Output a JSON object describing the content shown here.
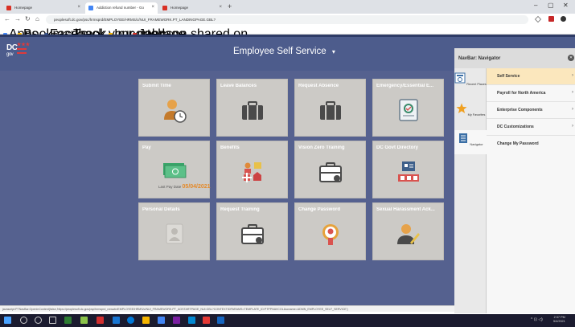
{
  "browser": {
    "tabs": [
      {
        "label": "Homepage",
        "fav_color": "#d93025",
        "active": false
      },
      {
        "label": "Addiction refund number - Go",
        "fav_color": "#4285f4",
        "active": true
      },
      {
        "label": "Homepage",
        "fav_color": "#d93025",
        "active": false
      }
    ],
    "new_tab": "+",
    "window_controls": {
      "minimize": "–",
      "maximize": "▢",
      "close": "✕"
    },
    "nav": {
      "back": "←",
      "forward": "→",
      "reload": "↻",
      "home": "⌂"
    },
    "url": "peoplesoft.dc.gov/psc/hrmsprd/EMPLOYEE/HRMS/c/NUI_FRAMEWORK.PT_LANDINGPAGE.GBL?",
    "bookmarks": [
      {
        "label": "Apps",
        "color": "#4285f4"
      },
      {
        "label": "Bookmarks",
        "color": "#f4b400"
      },
      {
        "label": "Facebook",
        "color": "#3b5998"
      },
      {
        "label": "Track your package...",
        "color": "#aaaaaa"
      },
      {
        "label": "Imported",
        "color": "#f4b400"
      },
      {
        "label": "Johnson shared on...",
        "color": "#d93025"
      }
    ]
  },
  "app": {
    "logo_text": "DC",
    "logo_sub": "gov",
    "title": "Employee Self Service",
    "title_caret": "▾"
  },
  "tiles": [
    {
      "title": "Submit Time",
      "icon": "person-clock-icon"
    },
    {
      "title": "Leave Balances",
      "icon": "briefcase-icon"
    },
    {
      "title": "Request Absence",
      "icon": "briefcase-icon"
    },
    {
      "title": "Emergency/Essential E...",
      "icon": "document-gear-icon"
    },
    {
      "title": "Pay",
      "icon": "money-icon",
      "pay_label": "Last Pay Date",
      "pay_date": "05/04/2021"
    },
    {
      "title": "Benefits",
      "icon": "benefits-icon"
    },
    {
      "title": "Vision Zero Training",
      "icon": "training-briefcase-icon"
    },
    {
      "title": "DC Govt Directory",
      "icon": "directory-icon"
    },
    {
      "title": "Personal Details",
      "icon": "personal-details-icon"
    },
    {
      "title": "Request Training",
      "icon": "training-briefcase-icon"
    },
    {
      "title": "Change Password",
      "icon": "password-badge-icon"
    },
    {
      "title": "Sexual Harassment Ack...",
      "icon": "person-pen-icon"
    }
  ],
  "status_url": "javascript:PTNavBar.OpenInContent(false,'https://peoplesoft.dc.gov/psp/hrmsprd_newwin/EMPLOYEE/HRMS/c/NUI_FRAMEWORK.PT_AGSTARTPAGE_NUI.GBL?CONTEXTIDPARAMS=TEMPLATE_ID:PTPPNAVCOL&scname=ADMN_EMPLOYEE_SELF_SERVICE')",
  "navbar": {
    "title": "NavBar: Navigator",
    "close": "✕",
    "side": [
      {
        "label": "Recent Places",
        "icon": "recent-places-icon"
      },
      {
        "label": "My Favorites",
        "icon": "star-icon"
      },
      {
        "label": "Navigator",
        "icon": "navigator-icon"
      }
    ],
    "menu": [
      {
        "label": "Self Service",
        "chevron": "›"
      },
      {
        "label": "Payroll for North America",
        "chevron": "›"
      },
      {
        "label": "Enterprise Components",
        "chevron": "›"
      },
      {
        "label": "DC Customizations",
        "chevron": "›"
      },
      {
        "label": "Change My Password",
        "chevron": ""
      }
    ]
  },
  "taskbar": {
    "time": "2:37 PM",
    "date": "5/4/2021"
  },
  "colors": {
    "header": "#4d5c8c",
    "body": "#55618f",
    "tile": "#cccac6",
    "selected_menu": "#fbe7bd",
    "accent_orange": "#e48a2a"
  }
}
